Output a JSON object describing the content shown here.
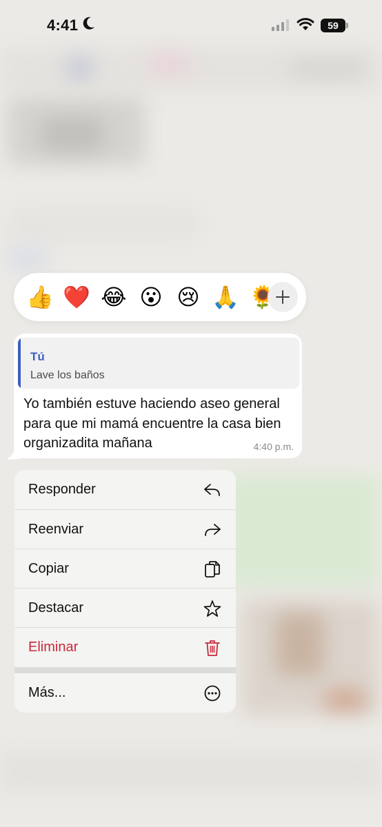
{
  "status_bar": {
    "time": "4:41",
    "battery": "59"
  },
  "reactions": {
    "emojis": [
      "👍",
      "❤️",
      "😂",
      "😮",
      "😢",
      "🙏",
      "🌻"
    ],
    "more_symbol": "+"
  },
  "message": {
    "quoted_author": "Tú",
    "quoted_text": "Lave los baños",
    "text": "Yo también estuve haciendo aseo general para que mi mamá encuentre la casa bien organizadita mañana",
    "time": "4:40 p.m."
  },
  "menu": {
    "reply": "Responder",
    "forward": "Reenviar",
    "copy": "Copiar",
    "star": "Destacar",
    "delete": "Eliminar",
    "more": "Más..."
  },
  "colors": {
    "accent_blue": "#3a5fbd",
    "danger_red": "#c8283c",
    "background": "#eceae6"
  }
}
